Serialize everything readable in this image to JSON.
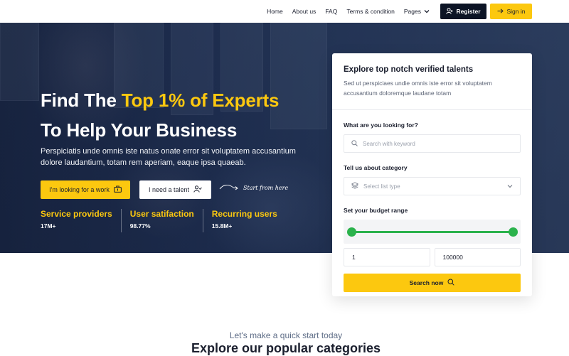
{
  "nav": {
    "items": [
      "Home",
      "About us",
      "FAQ",
      "Terms & condition",
      "Pages"
    ],
    "register_label": "Register",
    "signin_label": "Sign in"
  },
  "hero": {
    "title_line1_prefix": "Find The ",
    "title_line1_highlight": "Top 1% of Experts",
    "title_line2": "To Help Your Business",
    "description": "Perspiciatis unde omnis iste natus onate error sit voluptatem accusantium dolore laudantium, totam rem aperiam, eaque ipsa quaeab.",
    "btn_work": "I'm looking for a work",
    "btn_talent": "I need a talent",
    "start_here": "Start from here",
    "stats": [
      {
        "label": "Service providers",
        "value": "17M+"
      },
      {
        "label": "User satifaction",
        "value": "98.77%"
      },
      {
        "label": "Recurring users",
        "value": "15.8M+"
      }
    ]
  },
  "search_card": {
    "title": "Explore top notch verified talents",
    "subtitle": "Sed ut perspiciaes undie omnis iste error sit voluptatem accusantium doloremque laudane totam",
    "looking_label": "What are you looking for?",
    "keyword_placeholder": "Search with keyword",
    "category_label": "Tell us about category",
    "category_placeholder": "Select list type",
    "budget_label": "Set your budget range",
    "budget_slider_min": 0,
    "budget_slider_max": 1,
    "budget_min": "1",
    "budget_max": "100000",
    "search_button": "Search now"
  },
  "categories": {
    "pretitle": "Let's make a quick start today",
    "title": "Explore our popular categories"
  },
  "colors": {
    "accent": "#fcc80f",
    "dark": "#0c1425",
    "range": "#2bb24c"
  }
}
